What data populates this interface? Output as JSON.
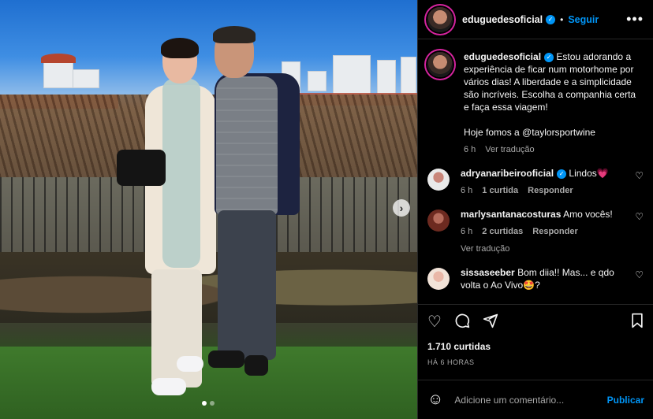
{
  "post": {
    "carousel": {
      "slide_count": 2,
      "active_index": 0,
      "next_glyph": "›"
    }
  },
  "header": {
    "username": "eduguedesoficial",
    "separator": "•",
    "follow_label": "Seguir",
    "more_glyph": "•••"
  },
  "caption": {
    "username": "eduguedesoficial",
    "text": "Estou adorando a experiência de ficar num motorhome por vários dias! A liberdade e a simplicidade são incríveis. Escolha a companhia certa e faça essa viagem!",
    "text2": "Hoje fomos a @taylorsportwine",
    "time": "6 h",
    "translate": "Ver tradução"
  },
  "comments": [
    {
      "username": "adryanaribeirooficial",
      "text": "Lindos💗",
      "time": "6 h",
      "likes": "1 curtida",
      "reply": "Responder"
    },
    {
      "username": "marlysantanacosturas",
      "text": "Amo vocês!",
      "time": "6 h",
      "likes": "2 curtidas",
      "reply": "Responder",
      "translate": "Ver tradução"
    },
    {
      "username": "sissaseeber",
      "text": "Bom diia!! Mas... e qdo volta o Ao Vivo🤩?"
    }
  ],
  "actions": {
    "likes_label": "1.710 curtidas",
    "time_label": "HÁ 6 HORAS"
  },
  "composer": {
    "placeholder": "Adicione um comentário...",
    "publish_label": "Publicar"
  },
  "icons": {
    "verified": "verified-badge-icon",
    "heart": "heart-icon",
    "comment": "comment-icon",
    "share": "share-icon",
    "save": "bookmark-icon",
    "emoji": "emoji-icon",
    "more": "more-options-icon"
  },
  "colors": {
    "accent": "#0095f6",
    "background": "#000000",
    "muted": "#a8a8a8"
  }
}
